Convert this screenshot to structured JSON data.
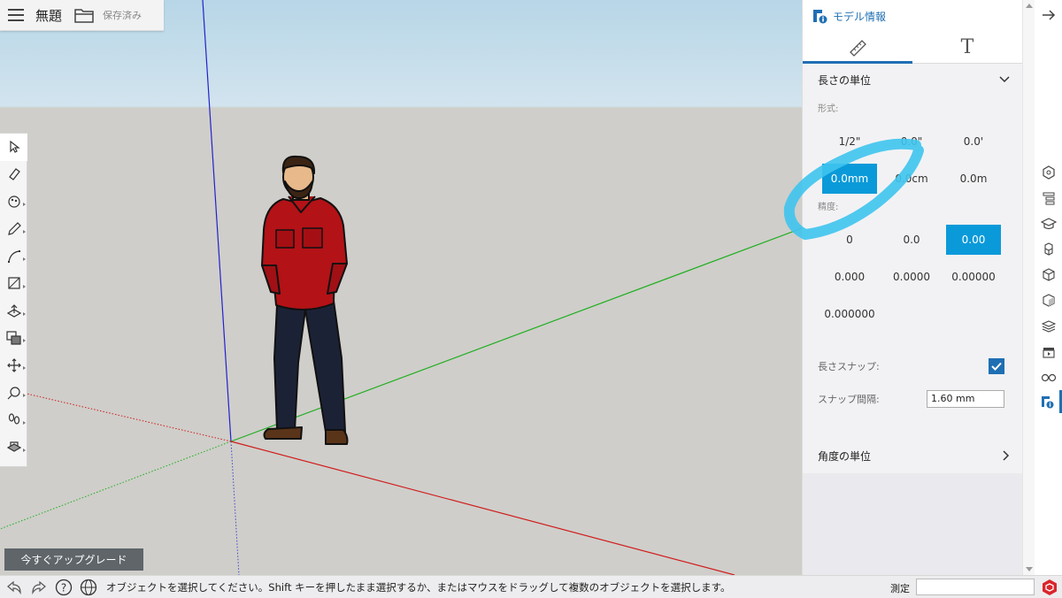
{
  "app": {
    "title": "無題",
    "saved_status": "保存済み"
  },
  "upgrade_label": "今すぐアップグレード",
  "panel": {
    "title": "モデル情報",
    "tabs": [
      {
        "icon": "ruler-icon",
        "label": ""
      },
      {
        "icon": "text-icon",
        "label": "T"
      }
    ],
    "length_units": {
      "header": "長さの単位",
      "format_label": "形式:",
      "formats": [
        "1/2\"",
        "0.0\"",
        "0.0'",
        "0.0mm",
        "0.0cm",
        "0.0m"
      ],
      "selected_format": "0.0mm",
      "precision_label": "精度:",
      "precisions": [
        "0",
        "0.0",
        "0.00",
        "0.000",
        "0.0000",
        "0.00000",
        "0.000000"
      ],
      "selected_precision": "0.00",
      "snap_label": "長さスナップ:",
      "snap_checked": true,
      "interval_label": "スナップ間隔:",
      "interval_value": "1.60 mm"
    },
    "angle_units": {
      "header": "角度の単位"
    }
  },
  "status": {
    "message": "オブジェクトを選択してください。Shift キーを押したまま選択するか、またはマウスをドラッグして複数のオブジェクトを選択します。",
    "measure_label": "測定",
    "measure_value": ""
  },
  "colors": {
    "accent": "#1f6fb3",
    "selected": "#0b9ad9",
    "annotation": "#3ec4ee",
    "axis_red": "#d01c1c",
    "axis_green": "#1fae1f",
    "axis_blue": "#2222cc"
  }
}
